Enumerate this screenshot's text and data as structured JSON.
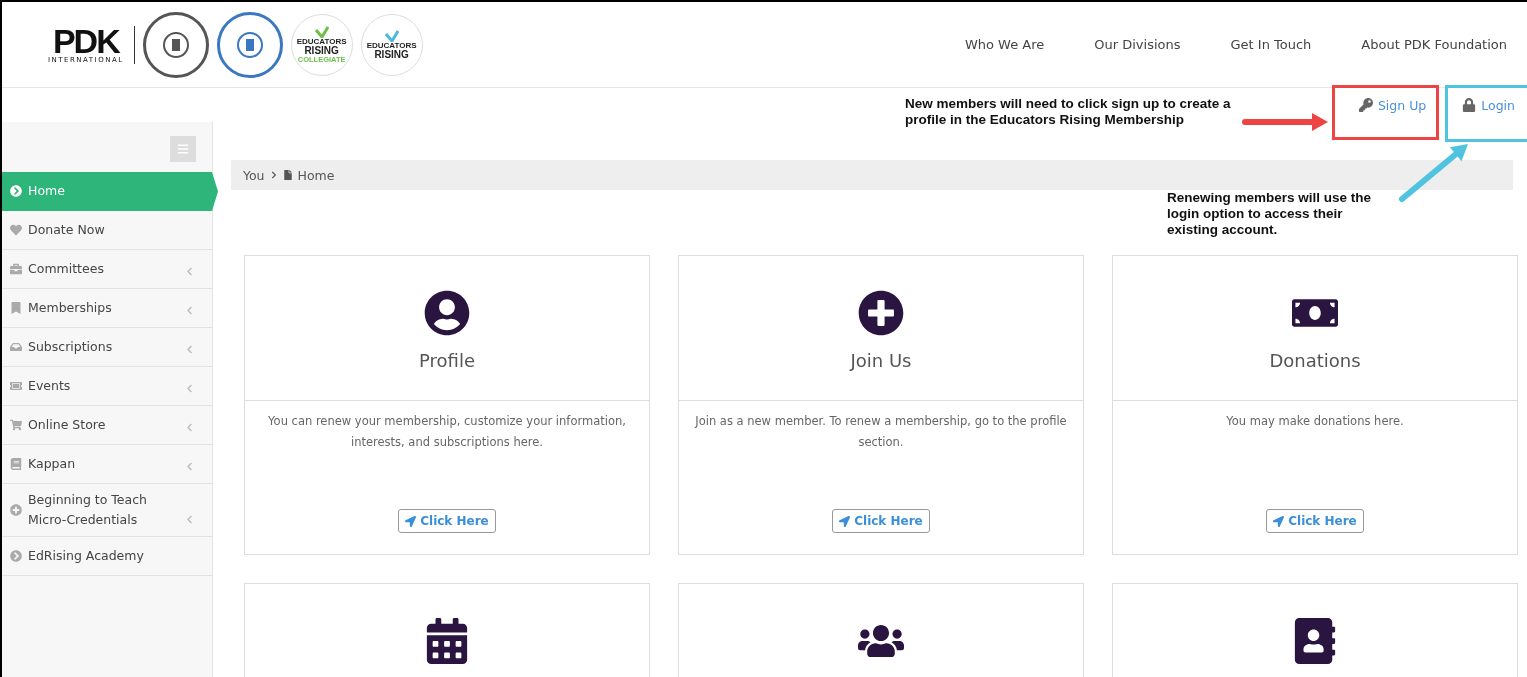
{
  "logo": {
    "wordmark": "PDK",
    "subtitle": "INTERNATIONAL",
    "badges": [
      {
        "kind": "seal",
        "color": "#555555"
      },
      {
        "kind": "seal",
        "color": "#3a78c2"
      },
      {
        "kind": "rising",
        "color": "#6cc04a",
        "line1": "EDUCATORS",
        "line2": "RISING",
        "line3": "COLLEGIATE"
      },
      {
        "kind": "rising",
        "color": "#4ab8e0",
        "line1": "EDUCATORS",
        "line2": "RISING"
      }
    ]
  },
  "top_nav": [
    "Who We Are",
    "Our Divisions",
    "Get In Touch",
    "About PDK Foundation"
  ],
  "account_links": [
    {
      "kind": "signup",
      "label": "Sign Up"
    },
    {
      "kind": "login",
      "label": "Login"
    }
  ],
  "sidebar": {
    "items": [
      {
        "label": "Home",
        "selected": true,
        "expandable": false
      },
      {
        "label": "Donate Now",
        "selected": false,
        "expandable": false
      },
      {
        "label": "Committees",
        "selected": false,
        "expandable": true
      },
      {
        "label": "Memberships",
        "selected": false,
        "expandable": true
      },
      {
        "label": "Subscriptions",
        "selected": false,
        "expandable": true
      },
      {
        "label": "Events",
        "selected": false,
        "expandable": true
      },
      {
        "label": "Online Store",
        "selected": false,
        "expandable": true
      },
      {
        "label": "Kappan",
        "selected": false,
        "expandable": true
      },
      {
        "label": "Beginning to Teach Micro-Credentials",
        "selected": false,
        "expandable": true
      },
      {
        "label": "EdRising Academy",
        "selected": false,
        "expandable": false
      }
    ]
  },
  "breadcrumb": [
    "You",
    "Home"
  ],
  "cards": [
    {
      "kind": "full",
      "title": "Profile",
      "description": "You can renew your membership, customize your information, interests, and subscriptions here.",
      "button": "Click Here"
    },
    {
      "kind": "full",
      "title": "Join Us",
      "description": "Join as a new member. To renew a membership, go to the profile section.",
      "button": "Click Here"
    },
    {
      "kind": "full",
      "title": "Donations",
      "description": "You may make donations here.",
      "button": "Click Here"
    },
    {
      "kind": "cut"
    },
    {
      "kind": "cut"
    },
    {
      "kind": "cut"
    }
  ],
  "annotations": [
    {
      "kind": "signup",
      "color": "#ef4444",
      "text": "New members will need to click sign up to create a profile in the Educators Rising Membership"
    },
    {
      "kind": "login",
      "color": "#4fc3e0",
      "text": "Renewing members will use the login option to access their existing account."
    }
  ]
}
